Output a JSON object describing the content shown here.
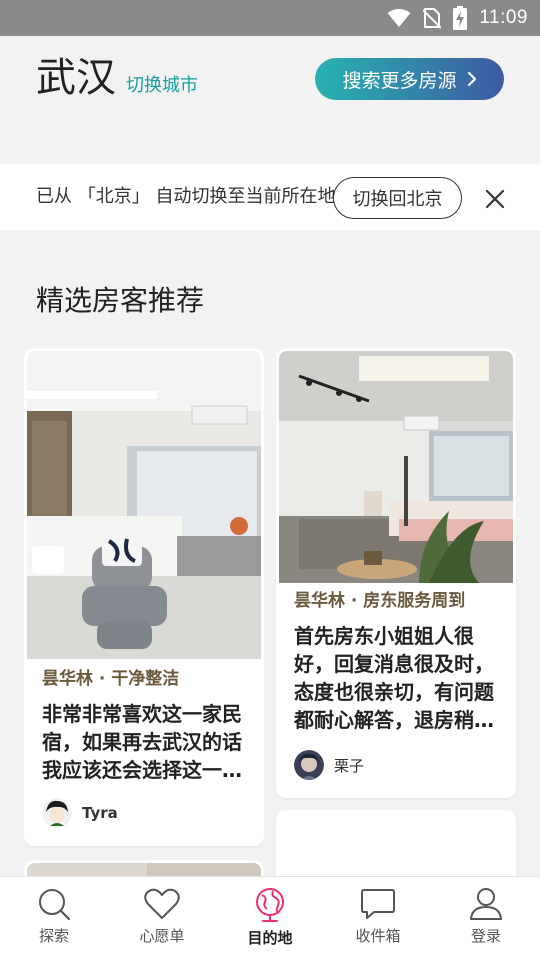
{
  "status_bar": {
    "time": "11:09"
  },
  "header": {
    "city": "武汉",
    "switch_city": "切换城市",
    "search_button": "搜索更多房源"
  },
  "notice": {
    "text": "已从 「北京」 自动切换至当前所在地",
    "switch_back": "切换回北京"
  },
  "section": {
    "title": "精选房客推荐"
  },
  "cards": [
    {
      "tag": "昙华林 · 干净整洁",
      "body": "非常非常喜欢这一家民宿，如果再去武汉的话我应该还会选择这一…",
      "author": "Tyra"
    },
    {
      "tag": "昙华林 · 房东服务周到",
      "body": "首先房东小姐姐人很好，回复消息很及时，态度也很亲切，有问题都耐心解答，退房稍…",
      "author": "栗子"
    }
  ],
  "tabs": [
    {
      "label": "探索",
      "icon": "search-icon"
    },
    {
      "label": "心愿单",
      "icon": "heart-icon"
    },
    {
      "label": "目的地",
      "icon": "globe-icon",
      "active": true
    },
    {
      "label": "收件箱",
      "icon": "message-icon"
    },
    {
      "label": "登录",
      "icon": "user-icon"
    }
  ],
  "colors": {
    "accent_teal": "#1aa0a0",
    "gradient_start": "#27b3b0",
    "gradient_end": "#3f5aa3",
    "active_tab": "#e8336b",
    "tag_brown": "#6b5a3e"
  }
}
